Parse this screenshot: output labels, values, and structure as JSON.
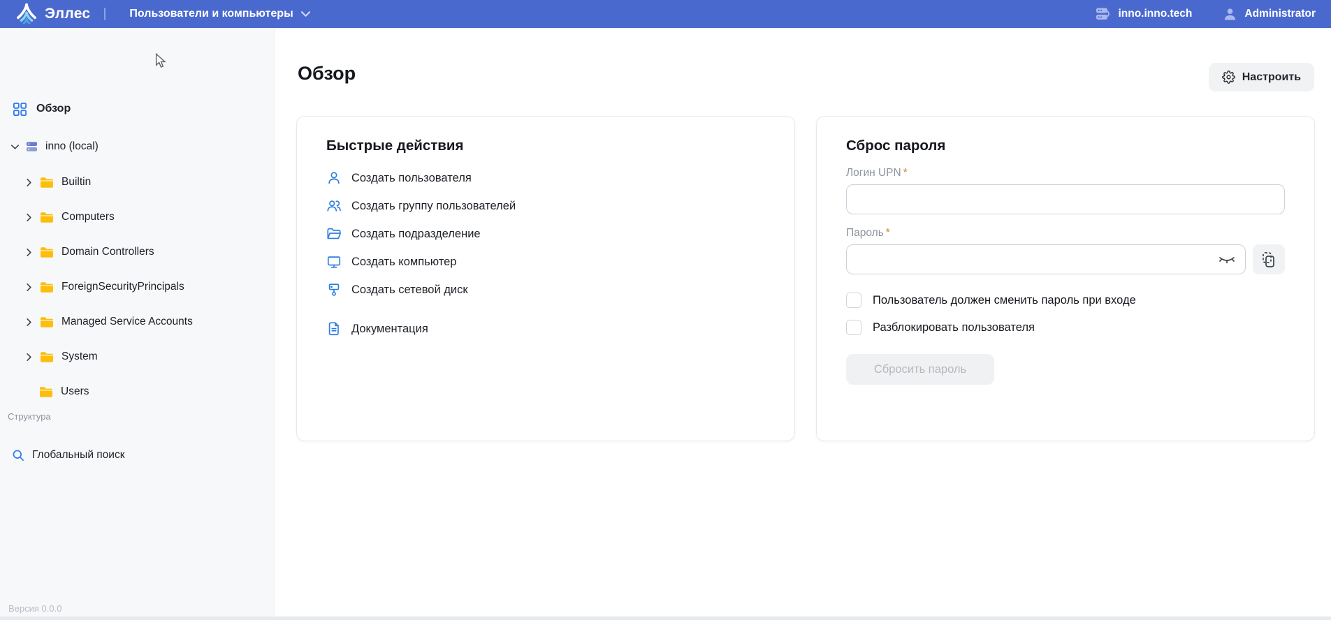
{
  "header": {
    "logo": "Эллес",
    "nav_dropdown": "Пользователи и компьютеры",
    "server": "inno.inno.tech",
    "user": "Administrator"
  },
  "sidebar": {
    "overview": "Обзор",
    "tree_root": "inno (local)",
    "folders": [
      "Builtin",
      "Computers",
      "Domain Controllers",
      "ForeignSecurityPrincipals",
      "Managed Service Accounts",
      "System",
      "Users"
    ],
    "section_label": "Структура",
    "global_search": "Глобальный поиск",
    "version": "Версия 0.0.0"
  },
  "main": {
    "title": "Обзор",
    "configure_button": "Настроить"
  },
  "quick_actions": {
    "title": "Быстрые действия",
    "items": [
      {
        "icon": "create-user-icon",
        "label": "Создать пользователя"
      },
      {
        "icon": "create-group-icon",
        "label": "Создать группу пользователей"
      },
      {
        "icon": "create-ou-icon",
        "label": "Создать подразделение"
      },
      {
        "icon": "create-computer-icon",
        "label": "Создать компьютер"
      },
      {
        "icon": "create-network-drive-icon",
        "label": "Создать сетевой диск"
      }
    ],
    "docs_label": "Документация"
  },
  "password_reset": {
    "title": "Сброс пароля",
    "login_label": "Логин UPN",
    "password_label": "Пароль",
    "required_mark": "*",
    "login_value": "",
    "password_value": "",
    "checkboxes": [
      {
        "label": "Пользователь должен сменить пароль при входе",
        "checked": false
      },
      {
        "label": "Разблокировать пользователя",
        "checked": false
      }
    ],
    "submit_button": "Сбросить пароль",
    "submit_enabled": false
  },
  "colors": {
    "header_bg": "#4a69cf",
    "accent_blue": "#2b7de0",
    "folder_amber": "#fcbe0b",
    "required_mark": "#c87e2a",
    "sidebar_bg": "#f7f8fa",
    "muted_text": "#8d939b",
    "disabled_text": "#b4b9bf"
  }
}
